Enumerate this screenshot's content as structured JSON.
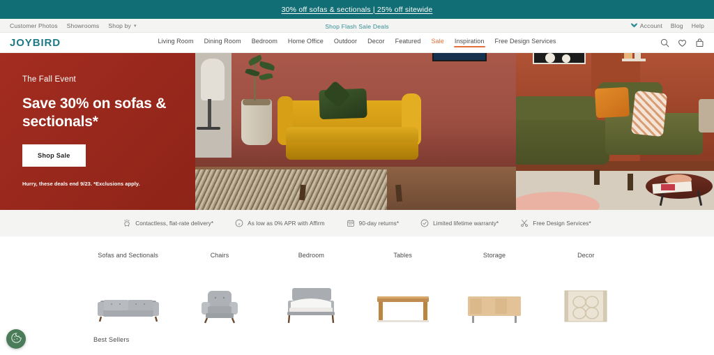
{
  "promo": {
    "text": "30% off sofas & sectionals | 25% off sitewide",
    "bg_color": "#116E74"
  },
  "utility_bar": {
    "left_links": [
      {
        "label": "Customer Photos"
      },
      {
        "label": "Showrooms"
      },
      {
        "label": "Shop by",
        "has_chevron": true
      }
    ],
    "center_link": {
      "label": "Shop Flash Sale Deals",
      "color": "#2f8d96"
    },
    "right_links": [
      {
        "label": "Account",
        "icon": "bird-icon"
      },
      {
        "label": "Blog"
      },
      {
        "label": "Help"
      }
    ]
  },
  "header": {
    "logo": "JOYBIRD",
    "logo_color": "#1d7a85",
    "nav": [
      {
        "label": "Living Room",
        "state": "default"
      },
      {
        "label": "Dining Room",
        "state": "default"
      },
      {
        "label": "Bedroom",
        "state": "default"
      },
      {
        "label": "Home Office",
        "state": "default"
      },
      {
        "label": "Outdoor",
        "state": "default"
      },
      {
        "label": "Decor",
        "state": "default"
      },
      {
        "label": "Featured",
        "state": "default"
      },
      {
        "label": "Sale",
        "state": "sale"
      },
      {
        "label": "Inspiration",
        "state": "active"
      },
      {
        "label": "Free Design Services",
        "state": "default"
      }
    ],
    "icons": [
      {
        "name": "search-icon"
      },
      {
        "name": "heart-icon"
      },
      {
        "name": "shopping-bag-icon"
      }
    ],
    "accent_color": "#E3703A"
  },
  "hero": {
    "eyebrow": "The Fall Event",
    "title": "Save 30% on sofas & sectionals*",
    "cta_label": "Shop Sale",
    "fine_print": "Hurry, these deals end 9/23. *Exclusions apply.",
    "bg_color": "#9E2A1E",
    "image_left_alt": "Mustard yellow sofa with green pillow in terracotta living room",
    "image_right_alt": "Olive green sectional with orange pillow and coffee table"
  },
  "benefits": [
    {
      "label": "Contactless, flat-rate delivery*",
      "icon": "delivery-icon"
    },
    {
      "label": "As low as 0% APR with Affirm",
      "icon": "affirm-icon"
    },
    {
      "label": "90-day returns*",
      "icon": "calendar-icon"
    },
    {
      "label": "Limited lifetime warranty*",
      "icon": "check-circle-icon"
    },
    {
      "label": "Free Design Services*",
      "icon": "scissors-icon"
    }
  ],
  "categories": [
    {
      "label": "Sofas and Sectionals",
      "thumb": "sofa-thumbnail"
    },
    {
      "label": "Chairs",
      "thumb": "armchair-thumbnail"
    },
    {
      "label": "Bedroom",
      "thumb": "bed-thumbnail"
    },
    {
      "label": "Tables",
      "thumb": "table-thumbnail"
    },
    {
      "label": "Storage",
      "thumb": "sideboard-thumbnail"
    },
    {
      "label": "Decor",
      "thumb": "rug-thumbnail"
    }
  ],
  "sections": {
    "best_sellers_heading": "Best Sellers"
  },
  "cookie_widget": {
    "icon": "cookie-icon",
    "color": "#4a7c59"
  }
}
